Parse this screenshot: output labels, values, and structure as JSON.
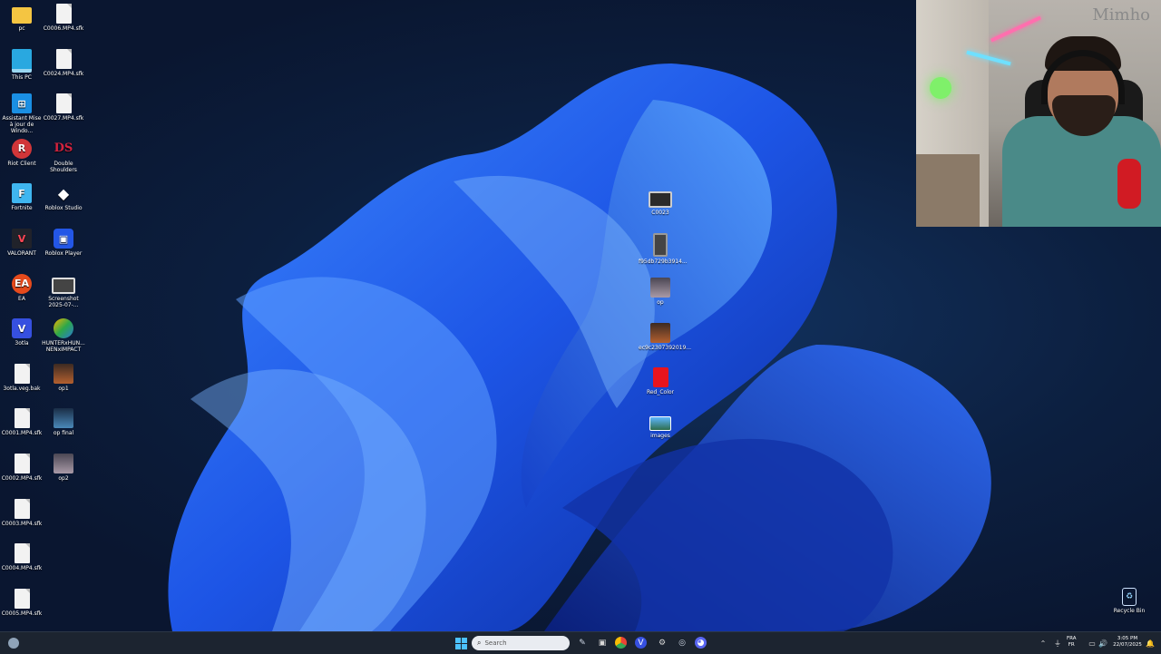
{
  "desktop": {
    "icons_left": [
      {
        "label": "pc",
        "glyph": "folder",
        "icon": "folder-icon"
      },
      {
        "label": "C0006.MP4.sfk",
        "glyph": "file",
        "icon": "file-icon"
      },
      {
        "label": "This PC",
        "glyph": "pc",
        "icon": "computer-icon"
      },
      {
        "label": "C0024.MP4.sfk",
        "glyph": "file",
        "icon": "file-icon"
      },
      {
        "label": "Assistant Mise à jour de Windo...",
        "glyph": "win",
        "icon": "windows-update-icon"
      },
      {
        "label": "C0027.MP4.sfk",
        "glyph": "file",
        "icon": "file-icon"
      },
      {
        "label": "Riot Client",
        "glyph": "riot",
        "icon": "riot-client-icon"
      },
      {
        "label": "Double Shoulders",
        "glyph": "ds",
        "icon": "double-shoulders-icon"
      },
      {
        "label": "Fortnite",
        "glyph": "fortnite",
        "icon": "fortnite-icon"
      },
      {
        "label": "Roblox Studio",
        "glyph": "roblox",
        "icon": "roblox-studio-icon"
      },
      {
        "label": "VALORANT",
        "glyph": "valorant",
        "icon": "valorant-icon"
      },
      {
        "label": "Roblox Player",
        "glyph": "rplayer",
        "icon": "roblox-player-icon"
      },
      {
        "label": "EA",
        "glyph": "ea",
        "icon": "ea-icon"
      },
      {
        "label": "Screenshot 2025-07-...",
        "glyph": "shot",
        "icon": "screenshot-icon"
      },
      {
        "label": "3otla",
        "glyph": "v",
        "icon": "vegas-icon"
      },
      {
        "label": "HUNTERxHUN... NENxIMPACT",
        "glyph": "hunter",
        "icon": "hunter-impact-icon"
      },
      {
        "label": "3otla.veg.bak",
        "glyph": "file",
        "icon": "file-icon"
      },
      {
        "label": "op1",
        "glyph": "anime",
        "icon": "image-icon"
      },
      {
        "label": "C0001.MP4.sfk",
        "glyph": "file",
        "icon": "file-icon"
      },
      {
        "label": "op final",
        "glyph": "opfinal",
        "icon": "image-icon"
      },
      {
        "label": "C0002.MP4.sfk",
        "glyph": "file",
        "icon": "file-icon"
      },
      {
        "label": "op2",
        "glyph": "op2",
        "icon": "image-icon"
      },
      {
        "label": "C0003.MP4.sfk",
        "glyph": "file",
        "icon": "file-icon"
      },
      {
        "label": "C0004.MP4.sfk",
        "glyph": "file",
        "icon": "file-icon"
      },
      {
        "label": "C0005.MP4.sfk",
        "glyph": "file",
        "icon": "file-icon"
      }
    ],
    "icons_middle": [
      {
        "label": "C0023",
        "glyph": "vid",
        "icon": "video-icon"
      },
      {
        "label": "f95db729b3914...",
        "glyph": "phone",
        "icon": "image-icon"
      },
      {
        "label": "op",
        "glyph": "op2",
        "icon": "image-icon"
      },
      {
        "label": "ec9c2307392019...",
        "glyph": "anime",
        "icon": "image-icon"
      },
      {
        "label": "Red_Color",
        "glyph": "red",
        "icon": "image-icon"
      },
      {
        "label": "images",
        "glyph": "images",
        "icon": "image-icon"
      }
    ],
    "recycle_bin": {
      "label": "Recycle Bin",
      "icon": "recycle-bin-icon"
    }
  },
  "webcam": {
    "brand": "Mimho"
  },
  "taskbar": {
    "search_placeholder": "Search",
    "tray": {
      "lang_top": "FRA",
      "lang_bottom": "FR",
      "time": "3:05 PM",
      "date": "22/07/2025"
    }
  }
}
